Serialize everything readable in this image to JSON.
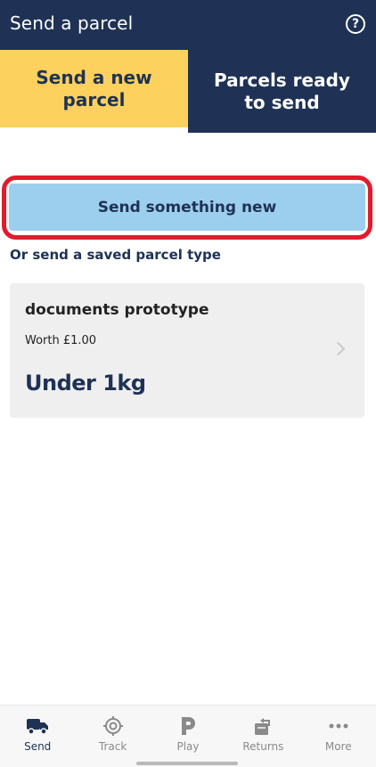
{
  "header": {
    "title": "Send a parcel",
    "help_symbol": "?"
  },
  "tabs": [
    {
      "label": "Send a new parcel",
      "active": true
    },
    {
      "label": "Parcels ready to send",
      "active": false
    }
  ],
  "main": {
    "primary_button": "Send something new",
    "saved_link": "Or send a saved parcel type",
    "saved_parcels": [
      {
        "title": "documents prototype",
        "worth": "Worth £1.00",
        "weight": "Under 1kg"
      }
    ]
  },
  "bottom_nav": {
    "items": [
      {
        "label": "Send",
        "icon": "van-icon",
        "active": true
      },
      {
        "label": "Track",
        "icon": "target-icon",
        "active": false
      },
      {
        "label": "Play",
        "icon": "play-p-icon",
        "active": false
      },
      {
        "label": "Returns",
        "icon": "returns-icon",
        "active": false
      },
      {
        "label": "More",
        "icon": "more-dots-icon",
        "active": false
      }
    ]
  },
  "colors": {
    "navy": "#1f3255",
    "yellow": "#fdd15d",
    "button_blue": "#9ccfee",
    "highlight_red": "#e21b2b",
    "card_bg": "#efefef"
  }
}
